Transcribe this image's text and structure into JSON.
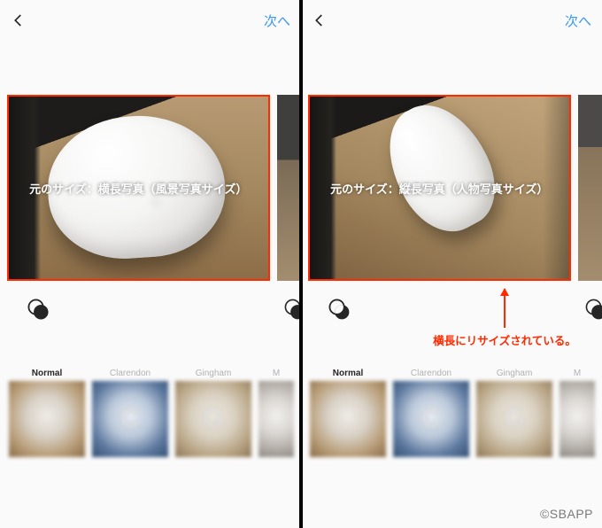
{
  "header": {
    "next_label": "次へ"
  },
  "left": {
    "overlay": "元のサイズ：横長写真（風景写真サイズ）"
  },
  "right": {
    "overlay": "元のサイズ：縦長写真（人物写真サイズ）",
    "annotation": "横長にリサイズされている。"
  },
  "filters": [
    {
      "label": "Normal",
      "letter": "",
      "selected": true
    },
    {
      "label": "Clarendon",
      "letter": "C",
      "selected": false
    },
    {
      "label": "Gingham",
      "letter": "G",
      "selected": false
    },
    {
      "label": "M",
      "letter": "",
      "selected": false,
      "truncated": true
    }
  ],
  "watermark": "©SBAPP"
}
